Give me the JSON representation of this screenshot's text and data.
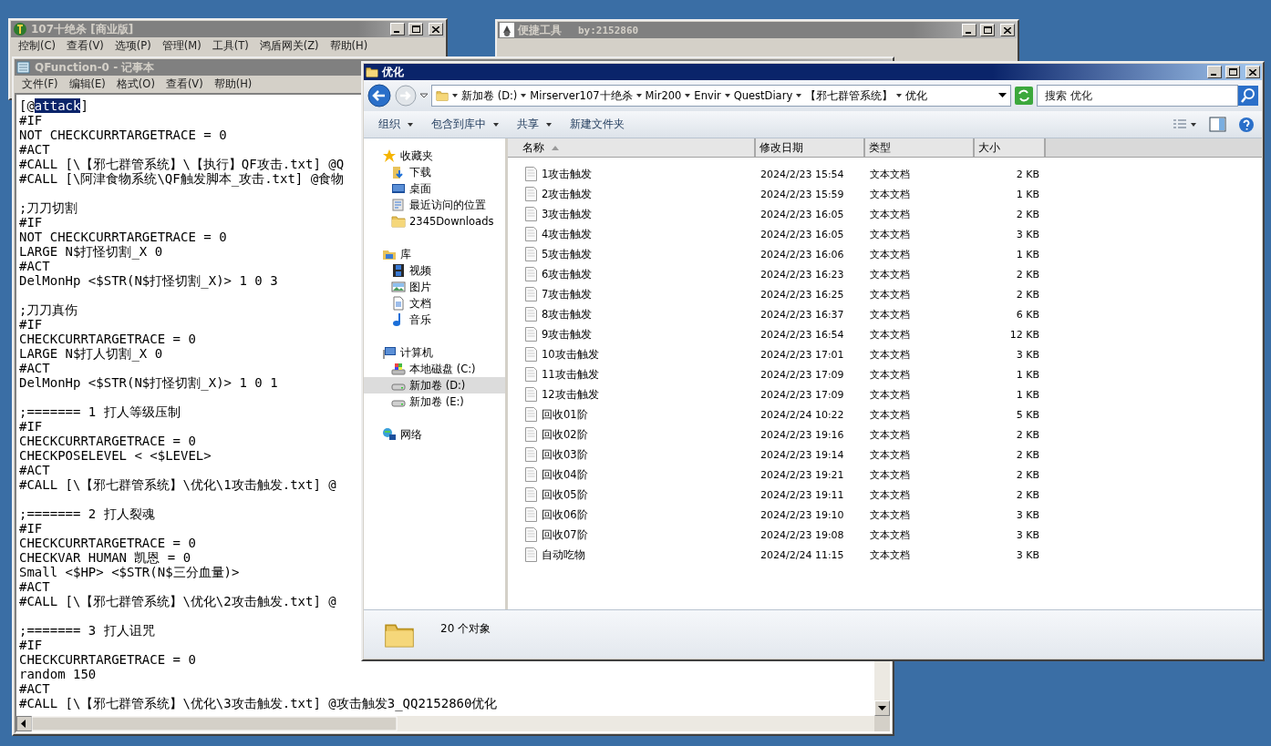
{
  "main_window": {
    "title": "107十绝杀 [商业版]",
    "active": false,
    "menu": [
      "控制(C)",
      "查看(V)",
      "选项(P)",
      "管理(M)",
      "工具(T)",
      "鸿盾网关(Z)",
      "帮助(H)"
    ]
  },
  "tool_window": {
    "title": "便捷工具",
    "subtitle": "by:2152860",
    "active": false
  },
  "notepad": {
    "title": "QFunction-0 - 记事本",
    "active": false,
    "menu": [
      "文件(F)",
      "编辑(E)",
      "格式(O)",
      "查看(V)",
      "帮助(H)"
    ],
    "blocks": [
      [
        {
          "parts": [
            {
              "text": "[@",
              "selected": false
            },
            {
              "text": "attack",
              "selected": true
            },
            {
              "text": "]",
              "selected": false
            }
          ]
        },
        {
          "text": "#IF"
        },
        {
          "text": "NOT CHECKCURRTARGETRACE = 0"
        },
        {
          "text": "#ACT"
        },
        {
          "text": "#CALL [\\【邪七群管系统】\\【执行】QF攻击.txt] @Q"
        },
        {
          "text": "#CALL [\\阿津食物系统\\QF触发脚本_攻击.txt] @食物"
        }
      ],
      [
        {
          "text": ";刀刀切割"
        },
        {
          "text": "#IF"
        },
        {
          "text": "NOT CHECKCURRTARGETRACE = 0"
        },
        {
          "text": "LARGE N$打怪切割_X 0"
        },
        {
          "text": "#ACT"
        },
        {
          "text": "DelMonHp <$STR(N$打怪切割_X)> 1 0 3"
        }
      ],
      [
        {
          "text": ";刀刀真伤"
        },
        {
          "text": "#IF"
        },
        {
          "text": "CHECKCURRTARGETRACE = 0"
        },
        {
          "text": "LARGE N$打人切割_X 0"
        },
        {
          "text": "#ACT"
        },
        {
          "text": "DelMonHp <$STR(N$打怪切割_X)> 1 0 1"
        }
      ],
      [
        {
          "text": ";======= 1 打人等级压制"
        },
        {
          "text": "#IF"
        },
        {
          "text": "CHECKCURRTARGETRACE = 0"
        },
        {
          "text": "CHECKPOSELEVEL < <$LEVEL>"
        },
        {
          "text": "#ACT"
        },
        {
          "text": "#CALL [\\【邪七群管系统】\\优化\\1攻击触发.txt] @"
        }
      ],
      [
        {
          "text": ";======= 2 打人裂魂"
        },
        {
          "text": "#IF"
        },
        {
          "text": "CHECKCURRTARGETRACE = 0"
        },
        {
          "text": "CHECKVAR HUMAN 凯恩 = 0"
        },
        {
          "text": "Small <$HP> <$STR(N$三分血量)>"
        },
        {
          "text": "#ACT"
        },
        {
          "text": "#CALL [\\【邪七群管系统】\\优化\\2攻击触发.txt] @"
        }
      ],
      [
        {
          "text": ";======= 3 打人诅咒"
        },
        {
          "text": "#IF"
        },
        {
          "text": "CHECKCURRTARGETRACE = 0"
        },
        {
          "text": "random 150"
        },
        {
          "text": "#ACT"
        },
        {
          "text": "#CALL [\\【邪七群管系统】\\优化\\3攻击触发.txt] @攻击触发3_QQ2152860优化"
        }
      ]
    ]
  },
  "explorer": {
    "title": "优化",
    "active": true,
    "breadcrumb": [
      "新加卷 (D:)",
      "Mirserver107十绝杀",
      "Mir200",
      "Envir",
      "QuestDiary",
      "【邪七群管系统】",
      "优化"
    ],
    "search": {
      "placeholder": "搜索 优化"
    },
    "toolbar": [
      {
        "label": "组织",
        "dropdown": true
      },
      {
        "label": "包含到库中",
        "dropdown": true
      },
      {
        "label": "共享",
        "dropdown": true
      },
      {
        "label": "新建文件夹",
        "dropdown": false
      }
    ],
    "nav": [
      {
        "label": "收藏夹",
        "kind": "star",
        "selected": false,
        "children": [
          {
            "label": "下载",
            "kind": "download",
            "selected": false
          },
          {
            "label": "桌面",
            "kind": "desktop",
            "selected": false
          },
          {
            "label": "最近访问的位置",
            "kind": "recent",
            "selected": false
          },
          {
            "label": "2345Downloads",
            "kind": "folder",
            "selected": false
          }
        ]
      },
      {
        "label": "库",
        "kind": "library",
        "selected": false,
        "children": [
          {
            "label": "视频",
            "kind": "video",
            "selected": false
          },
          {
            "label": "图片",
            "kind": "picture",
            "selected": false
          },
          {
            "label": "文档",
            "kind": "document",
            "selected": false
          },
          {
            "label": "音乐",
            "kind": "music",
            "selected": false
          }
        ]
      },
      {
        "label": "计算机",
        "kind": "computer",
        "selected": false,
        "children": [
          {
            "label": "本地磁盘 (C:)",
            "kind": "system-disk",
            "selected": false
          },
          {
            "label": "新加卷 (D:)",
            "kind": "drive",
            "selected": true
          },
          {
            "label": "新加卷 (E:)",
            "kind": "drive",
            "selected": false
          }
        ]
      },
      {
        "label": "网络",
        "kind": "network",
        "selected": false
      }
    ],
    "columns": [
      "名称",
      "修改日期",
      "类型",
      "大小"
    ],
    "rows": [
      {
        "name": "1攻击触发",
        "date": "2024/2/23 15:54",
        "type": "文本文档",
        "size": "2 KB"
      },
      {
        "name": "2攻击触发",
        "date": "2024/2/23 15:59",
        "type": "文本文档",
        "size": "1 KB"
      },
      {
        "name": "3攻击触发",
        "date": "2024/2/23 16:05",
        "type": "文本文档",
        "size": "2 KB"
      },
      {
        "name": "4攻击触发",
        "date": "2024/2/23 16:05",
        "type": "文本文档",
        "size": "3 KB"
      },
      {
        "name": "5攻击触发",
        "date": "2024/2/23 16:06",
        "type": "文本文档",
        "size": "1 KB"
      },
      {
        "name": "6攻击触发",
        "date": "2024/2/23 16:23",
        "type": "文本文档",
        "size": "2 KB"
      },
      {
        "name": "7攻击触发",
        "date": "2024/2/23 16:25",
        "type": "文本文档",
        "size": "2 KB"
      },
      {
        "name": "8攻击触发",
        "date": "2024/2/23 16:37",
        "type": "文本文档",
        "size": "6 KB"
      },
      {
        "name": "9攻击触发",
        "date": "2024/2/23 16:54",
        "type": "文本文档",
        "size": "12 KB"
      },
      {
        "name": "10攻击触发",
        "date": "2024/2/23 17:01",
        "type": "文本文档",
        "size": "3 KB"
      },
      {
        "name": "11攻击触发",
        "date": "2024/2/23 17:09",
        "type": "文本文档",
        "size": "1 KB"
      },
      {
        "name": "12攻击触发",
        "date": "2024/2/23 17:09",
        "type": "文本文档",
        "size": "1 KB"
      },
      {
        "name": "回收01阶",
        "date": "2024/2/24 10:22",
        "type": "文本文档",
        "size": "5 KB"
      },
      {
        "name": "回收02阶",
        "date": "2024/2/23 19:16",
        "type": "文本文档",
        "size": "2 KB"
      },
      {
        "name": "回收03阶",
        "date": "2024/2/23 19:14",
        "type": "文本文档",
        "size": "2 KB"
      },
      {
        "name": "回收04阶",
        "date": "2024/2/23 19:21",
        "type": "文本文档",
        "size": "2 KB"
      },
      {
        "name": "回收05阶",
        "date": "2024/2/23 19:11",
        "type": "文本文档",
        "size": "2 KB"
      },
      {
        "name": "回收06阶",
        "date": "2024/2/23 19:10",
        "type": "文本文档",
        "size": "3 KB"
      },
      {
        "name": "回收07阶",
        "date": "2024/2/23 19:08",
        "type": "文本文档",
        "size": "3 KB"
      },
      {
        "name": "自动吃物",
        "date": "2024/2/24 11:15",
        "type": "文本文档",
        "size": "3 KB"
      }
    ],
    "status": "20 个对象"
  }
}
